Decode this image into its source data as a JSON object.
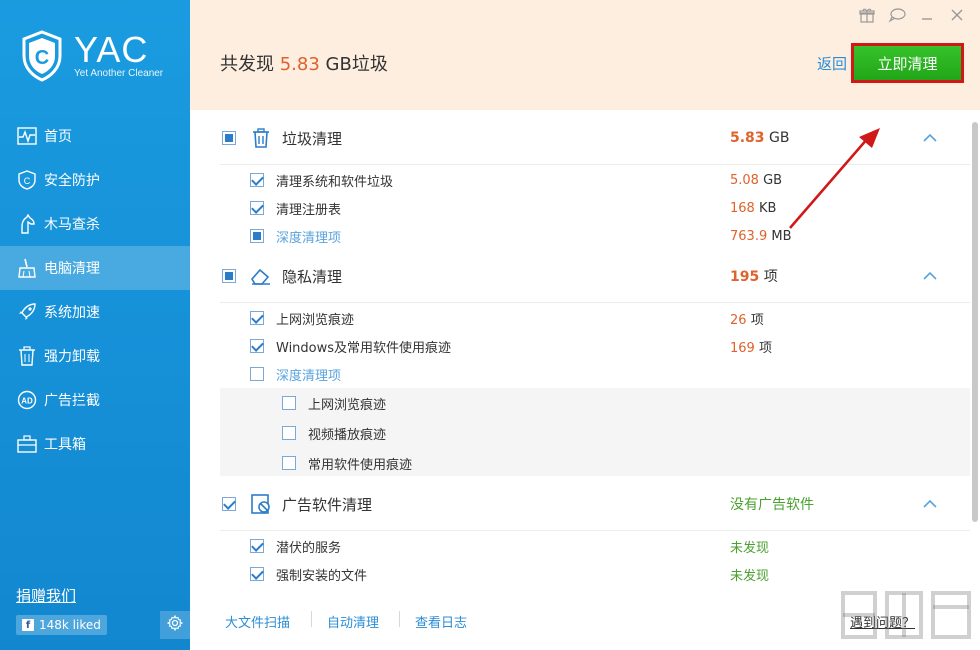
{
  "brand": {
    "name": "YAC",
    "tagline": "Yet Another Cleaner"
  },
  "sidebar": {
    "items": [
      {
        "label": "首页",
        "icon": "pulse-icon"
      },
      {
        "label": "安全防护",
        "icon": "shield-icon"
      },
      {
        "label": "木马查杀",
        "icon": "horse-icon"
      },
      {
        "label": "电脑清理",
        "icon": "broom-icon",
        "active": true
      },
      {
        "label": "系统加速",
        "icon": "rocket-icon"
      },
      {
        "label": "强力卸载",
        "icon": "trash-icon"
      },
      {
        "label": "广告拦截",
        "icon": "ad-icon"
      },
      {
        "label": "工具箱",
        "icon": "toolbox-icon"
      }
    ],
    "donate": "捐赠我们",
    "facebook_likes": "148k liked"
  },
  "header": {
    "found_prefix": "共发现",
    "found_value": "5.83",
    "found_suffix": "GB垃圾",
    "back": "返回",
    "clean_now": "立即清理"
  },
  "sections": {
    "junk": {
      "title": "垃圾清理",
      "size_value": "5.83",
      "size_unit": "GB",
      "items": [
        {
          "label": "清理系统和软件垃圾",
          "value": "5.08",
          "unit": "GB"
        },
        {
          "label": "清理注册表",
          "value": "168",
          "unit": "KB"
        },
        {
          "label": "深度清理项",
          "value": "763.9",
          "unit": "MB"
        }
      ]
    },
    "privacy": {
      "title": "隐私清理",
      "size_value": "195",
      "size_unit": "项",
      "items": [
        {
          "label": "上网浏览痕迹",
          "value": "26",
          "unit": "项"
        },
        {
          "label": "Windows及常用软件使用痕迹",
          "value": "169",
          "unit": "项"
        },
        {
          "label": "深度清理项"
        }
      ],
      "deep_items": [
        {
          "label": "上网浏览痕迹"
        },
        {
          "label": "视频播放痕迹"
        },
        {
          "label": "常用软件使用痕迹"
        }
      ]
    },
    "adware": {
      "title": "广告软件清理",
      "status": "没有广告软件",
      "items": [
        {
          "label": "潜伏的服务",
          "status": "未发现"
        },
        {
          "label": "强制安装的文件",
          "status": "未发现"
        }
      ]
    }
  },
  "footer": {
    "links": [
      "大文件扫描",
      "自动清理",
      "查看日志"
    ],
    "help": "遇到问题？"
  },
  "colors": {
    "accent_orange": "#e0622c",
    "sidebar_blue": "#1a9be0",
    "button_green": "#28b01e",
    "highlight_red": "#d01818"
  }
}
